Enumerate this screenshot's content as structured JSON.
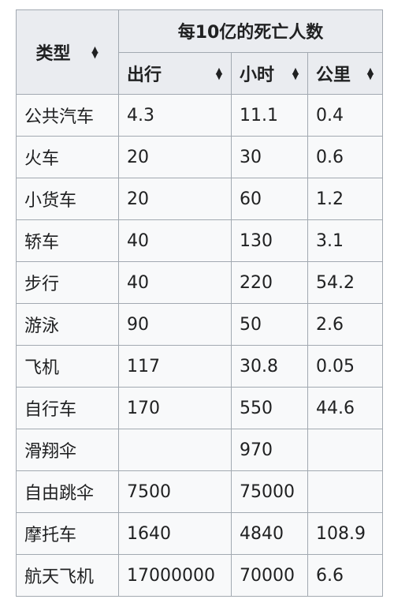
{
  "table": {
    "header": {
      "type_label": "类型",
      "group_label": "每10亿的死亡人数",
      "sub_labels": [
        "出行",
        "小时",
        "公里"
      ]
    },
    "rows": [
      {
        "type": "公共汽车",
        "trip": "4.3",
        "hour": "11.1",
        "km": "0.4"
      },
      {
        "type": "火车",
        "trip": "20",
        "hour": "30",
        "km": "0.6"
      },
      {
        "type": "小货车",
        "trip": "20",
        "hour": "60",
        "km": "1.2"
      },
      {
        "type": "轿车",
        "trip": "40",
        "hour": "130",
        "km": "3.1"
      },
      {
        "type": "步行",
        "trip": "40",
        "hour": "220",
        "km": "54.2"
      },
      {
        "type": "游泳",
        "trip": "90",
        "hour": "50",
        "km": "2.6"
      },
      {
        "type": "飞机",
        "trip": "117",
        "hour": "30.8",
        "km": "0.05"
      },
      {
        "type": "自行车",
        "trip": "170",
        "hour": "550",
        "km": "44.6"
      },
      {
        "type": "滑翔伞",
        "trip": "",
        "hour": "970",
        "km": ""
      },
      {
        "type": "自由跳伞",
        "trip": "7500",
        "hour": "75000",
        "km": ""
      },
      {
        "type": "摩托车",
        "trip": "1640",
        "hour": "4840",
        "km": "108.9"
      },
      {
        "type": "航天飞机",
        "trip": "17000000",
        "hour": "70000",
        "km": "6.6"
      }
    ]
  }
}
